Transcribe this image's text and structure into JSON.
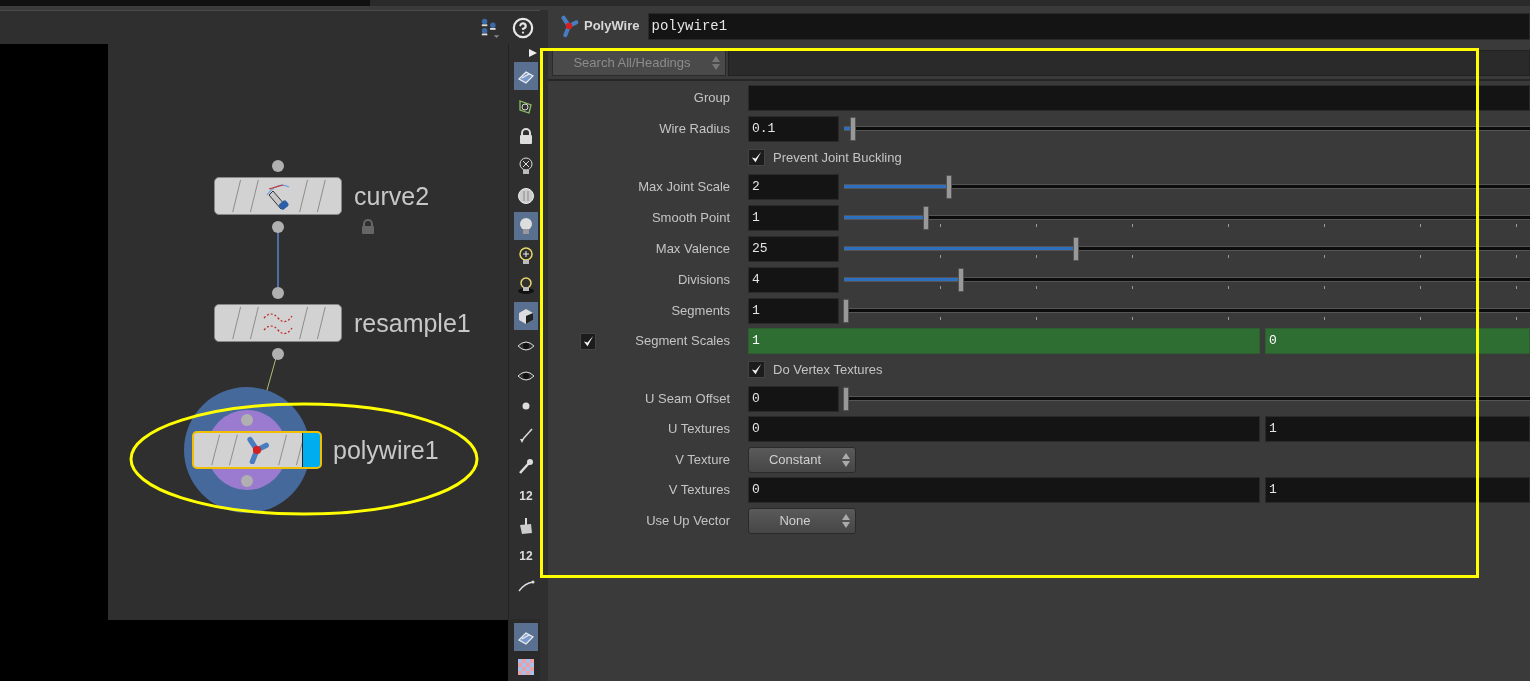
{
  "network": {
    "nodes": [
      {
        "name": "curve2",
        "kind": "curve",
        "locked": true,
        "selected": false,
        "display": false
      },
      {
        "name": "resample1",
        "kind": "resample",
        "locked": false,
        "selected": false,
        "display": false
      },
      {
        "name": "polywire1",
        "kind": "polywire",
        "locked": false,
        "selected": true,
        "display": true
      }
    ]
  },
  "toolbar": [
    {
      "kind": "plane",
      "selected": true
    },
    {
      "kind": "curve",
      "selected": false
    },
    {
      "kind": "lock",
      "selected": false
    },
    {
      "kind": "bulb-x",
      "selected": false
    },
    {
      "kind": "sphere",
      "selected": false
    },
    {
      "kind": "bulb",
      "selected": true
    },
    {
      "kind": "bulb-plus",
      "selected": false
    },
    {
      "kind": "bulb-ring",
      "selected": false
    },
    {
      "kind": "cube",
      "selected": true
    },
    {
      "kind": "eye",
      "selected": false
    },
    {
      "kind": "eye",
      "selected": false
    },
    {
      "kind": "dot",
      "selected": false
    },
    {
      "kind": "brush",
      "selected": false
    },
    {
      "kind": "pin",
      "selected": false
    },
    {
      "kind": "number",
      "label": "12",
      "selected": false
    },
    {
      "kind": "stamp",
      "selected": false
    },
    {
      "kind": "number",
      "label": "12",
      "selected": false
    },
    {
      "kind": "line",
      "selected": false
    }
  ],
  "bottom_tools": [
    {
      "kind": "plane",
      "selected": true
    },
    {
      "kind": "checker",
      "selected": false
    }
  ],
  "parameters": {
    "node_type": "PolyWire",
    "node_name": "polywire1",
    "search": "Search All/Headings",
    "rows": [
      {
        "kind": "text",
        "label": "Group"
      },
      {
        "kind": "slider",
        "label": "Wire Radius",
        "value": "0.1",
        "level": 0.01,
        "ticks": false
      },
      {
        "kind": "toggle",
        "label": "Prevent Joint Buckling",
        "checked": true
      },
      {
        "kind": "slider",
        "label": "Max Joint Scale",
        "value": "2",
        "level": 0.15,
        "ticks": false
      },
      {
        "kind": "slider",
        "label": "Smooth Point",
        "value": "1",
        "level": 0.117,
        "ticks": true
      },
      {
        "kind": "slider",
        "label": "Max Valence",
        "value": "25",
        "level": 0.335,
        "ticks": true
      },
      {
        "kind": "slider",
        "label": "Divisions",
        "value": "4",
        "level": 0.167,
        "ticks": true
      },
      {
        "kind": "slider",
        "label": "Segments",
        "value": "1",
        "level": 0,
        "ticks": true
      },
      {
        "kind": "vector",
        "label": "Segment Scales",
        "values": [
          "1",
          "0"
        ],
        "animated": true,
        "enabled": true
      },
      {
        "kind": "toggle",
        "label": "Do Vertex Textures",
        "checked": true
      },
      {
        "kind": "slider",
        "label": "U Seam Offset",
        "value": "0",
        "level": 0,
        "ticks": false
      },
      {
        "kind": "vector",
        "label": "U Textures",
        "values": [
          "0",
          "1"
        ],
        "animated": false
      },
      {
        "kind": "menu",
        "label": "V Texture",
        "value": "Constant"
      },
      {
        "kind": "vector",
        "label": "V Textures",
        "values": [
          "0",
          "1"
        ],
        "animated": false
      },
      {
        "kind": "menu",
        "label": "Use Up Vector",
        "value": "None"
      }
    ]
  }
}
